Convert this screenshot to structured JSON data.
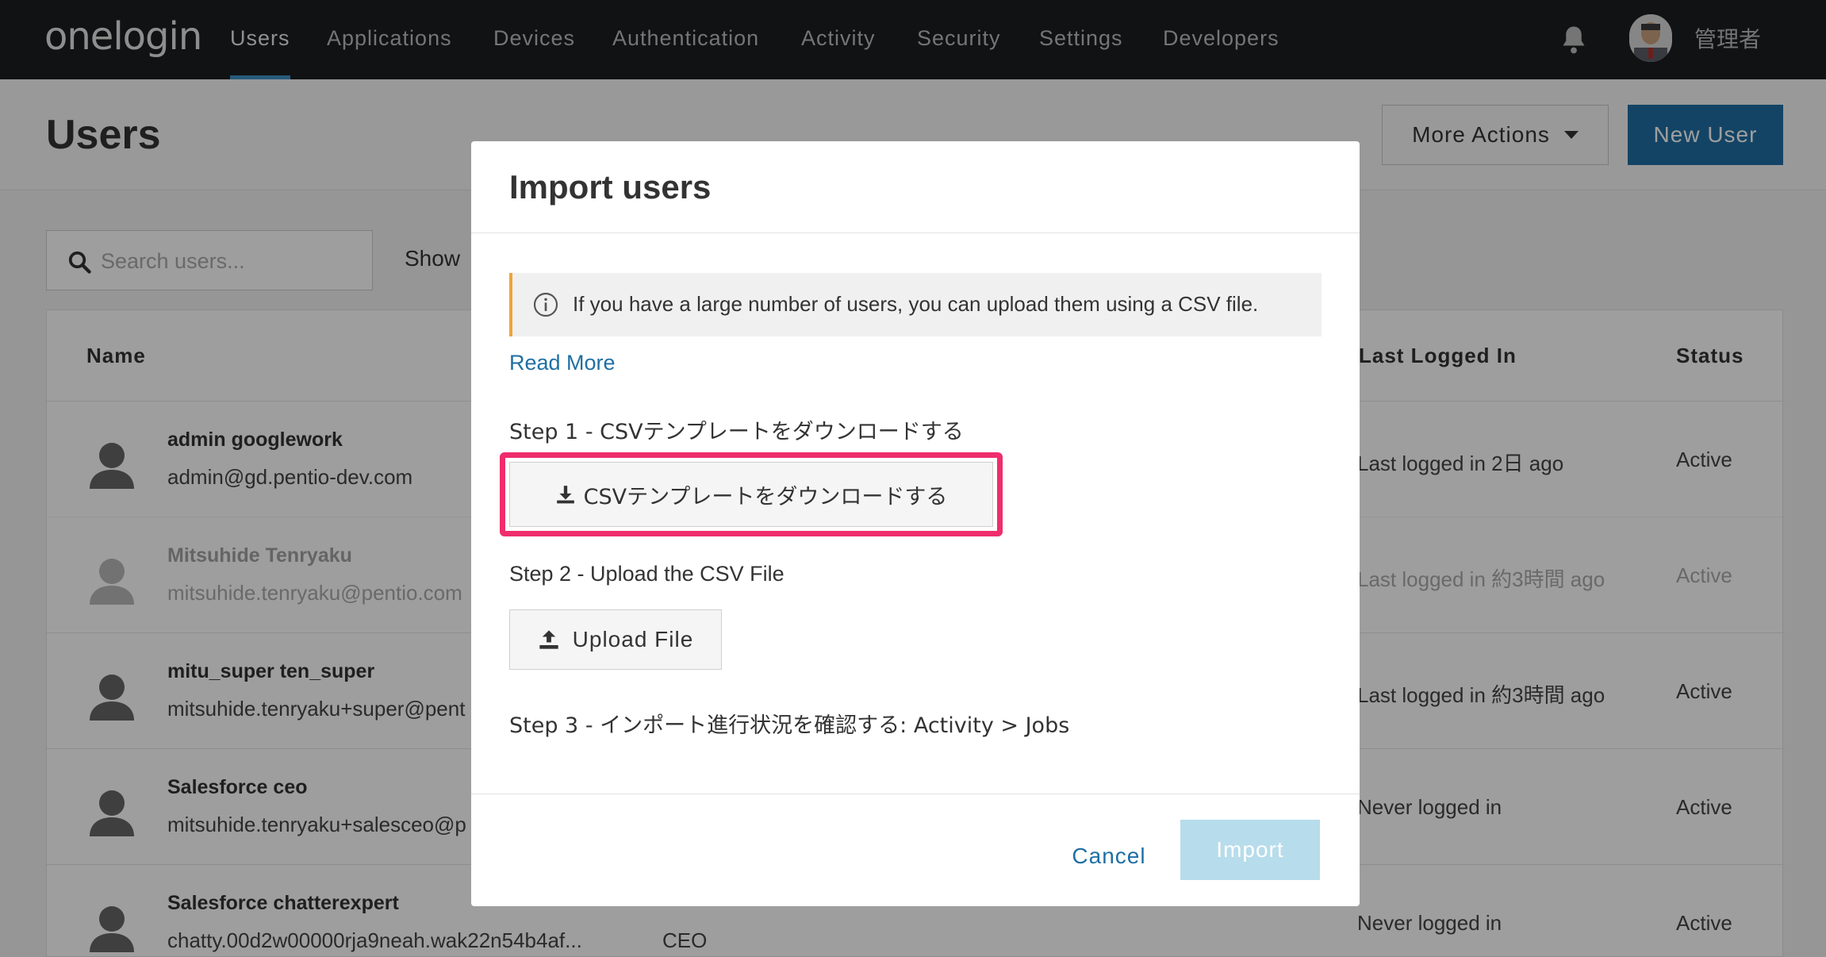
{
  "nav": {
    "logo": "onelogin",
    "items": [
      "Users",
      "Applications",
      "Devices",
      "Authentication",
      "Activity",
      "Security",
      "Settings",
      "Developers"
    ],
    "active": "Users",
    "user_name": "管理者"
  },
  "page": {
    "title": "Users",
    "more_actions": "More Actions",
    "new_user": "New User",
    "search_placeholder": "Search users...",
    "show_label": "Show"
  },
  "table": {
    "headers": {
      "name": "Name",
      "last_logged_in": "Last Logged In",
      "status": "Status"
    },
    "rows": [
      {
        "name": "admin googlework",
        "email": "admin@gd.pentio-dev.com",
        "title": "",
        "last": "Last logged in 2日 ago",
        "status": "Active"
      },
      {
        "name": "Mitsuhide Tenryaku",
        "email": "mitsuhide.tenryaku@pentio.com",
        "title": "",
        "last": "Last logged in 約3時間 ago",
        "status": "Active"
      },
      {
        "name": "mitu_super ten_super",
        "email": "mitsuhide.tenryaku+super@pent",
        "title": "",
        "last": "Last logged in 約3時間 ago",
        "status": "Active"
      },
      {
        "name": "Salesforce ceo",
        "email": "mitsuhide.tenryaku+salesceo@p",
        "title": "",
        "last": "Never logged in",
        "status": "Active"
      },
      {
        "name": "Salesforce chatterexpert",
        "email": "chatty.00d2w00000rja9neah.wak22n54b4af...",
        "title": "CEO",
        "last": "Never logged in",
        "status": "Active"
      }
    ]
  },
  "modal": {
    "title": "Import users",
    "info": "If you have a large number of users, you can upload them using a CSV file.",
    "read_more": "Read More",
    "step1": "Step 1 - CSVテンプレートをダウンロードする",
    "download_button": "CSVテンプレートをダウンロードする",
    "step2": "Step 2 - Upload the CSV File",
    "upload_button": "Upload File",
    "step3": "Step 3 - インポート進行状況を確認する: Activity > Jobs",
    "cancel": "Cancel",
    "import": "Import"
  },
  "colors": {
    "nav_bg": "#1b1e20",
    "accent": "#1f6fa3",
    "highlight": "#ef2d6d",
    "info_border": "#f0a23a",
    "import_disabled": "#b7dceb"
  }
}
